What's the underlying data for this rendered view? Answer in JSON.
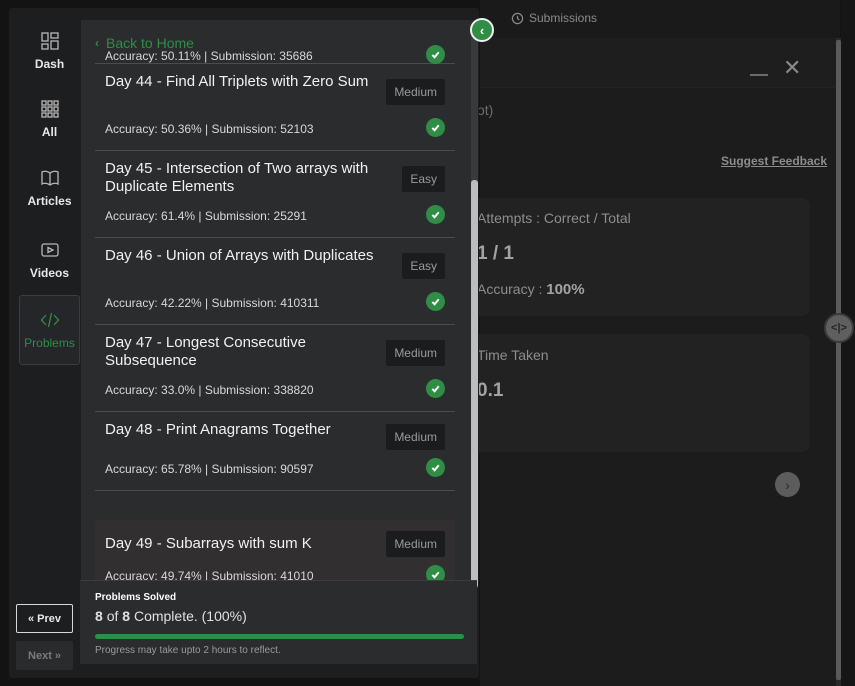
{
  "background": {
    "submissions_tab": "Submissions",
    "problem_type_fragment": "ot)",
    "suggest_feedback": "Suggest Feedback",
    "attempts_label": "Attempts : Correct / Total",
    "attempts_value": "1 / 1",
    "accuracy_label": "Accuracy :",
    "accuracy_value": "100%",
    "time_label": "Time Taken",
    "time_value": "0.1"
  },
  "nav": {
    "items": [
      {
        "label": "Dash",
        "icon": "dashboard-icon"
      },
      {
        "label": "All",
        "icon": "grid-icon"
      },
      {
        "label": "Articles",
        "icon": "book-icon"
      },
      {
        "label": "Videos",
        "icon": "video-icon"
      },
      {
        "label": "Problems",
        "icon": "code-icon",
        "active": true
      }
    ],
    "prev_label": "Prev",
    "next_label": "Next"
  },
  "list": {
    "back_label": "Back to Home",
    "partial_accuracy": "Accuracy: 50.11% | Submission: 35686",
    "items": [
      {
        "title": "Day 44 - Find All Triplets with Zero Sum",
        "difficulty": "Medium",
        "stats": "Accuracy: 50.36% | Submission: 52103"
      },
      {
        "title": "Day 45 - Intersection of Two arrays with Duplicate Elements",
        "difficulty": "Easy",
        "stats": "Accuracy: 61.4% | Submission: 25291"
      },
      {
        "title": "Day 46 - Union of Arrays with Duplicates",
        "difficulty": "Easy",
        "stats": "Accuracy: 42.22% | Submission: 410311"
      },
      {
        "title": "Day 47 - Longest Consecutive Subsequence",
        "difficulty": "Medium",
        "stats": "Accuracy: 33.0% | Submission: 338820"
      },
      {
        "title": "Day 48 - Print Anagrams Together",
        "difficulty": "Medium",
        "stats": "Accuracy: 65.78% | Submission: 90597"
      },
      {
        "title": "Day 49 - Subarrays with sum K",
        "difficulty": "Medium",
        "stats": "Accuracy: 49.74% | Submission: 41010"
      }
    ]
  },
  "progress": {
    "label": "Problems Solved",
    "solved": "8",
    "of_word": "of",
    "total": "8",
    "status": "Complete. (100%)",
    "percent": 100,
    "note": "Progress may take upto 2 hours to reflect."
  },
  "colors": {
    "accent": "#2f8d46",
    "panel": "#2b2c2e",
    "sidebar": "#1d1e20"
  }
}
